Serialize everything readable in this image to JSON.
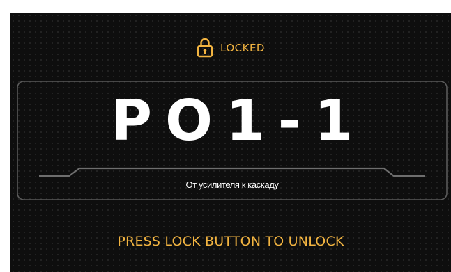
{
  "lock_status": {
    "label": "LOCKED",
    "icon": "padlock-icon"
  },
  "preset": {
    "number": "PO1-1",
    "name": "От усилителя к каскаду"
  },
  "hint": {
    "text": "PRESS LOCK BUTTON TO UNLOCK"
  },
  "colors": {
    "accent": "#f2b441",
    "background": "#0e0e0e",
    "frame_border": "#5a5a5a",
    "text": "#ffffff"
  }
}
